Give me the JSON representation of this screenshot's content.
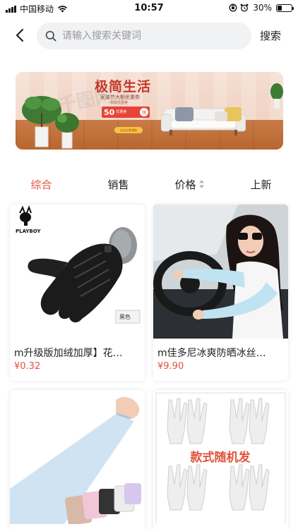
{
  "status_bar": {
    "carrier": "中国移动",
    "time": "10:57",
    "battery": "30%",
    "battery_level": 0.3
  },
  "header": {
    "back_icon": "chevron-left-icon",
    "search_icon": "search-icon",
    "search_placeholder": "请输入搜索关键词",
    "search_value": "",
    "search_button": "搜索"
  },
  "banner": {
    "title": "极简生活",
    "subtitle": "家装节大额优惠券",
    "small_text": "领取优惠券",
    "coupon_value": "50",
    "coupon_label": "优惠券",
    "coupon_badge": "领",
    "button_text": "点击立即领取"
  },
  "tabs": [
    {
      "label": "综合",
      "active": true
    },
    {
      "label": "销售",
      "active": false
    },
    {
      "label": "价格",
      "active": false,
      "icon": "sort-icon"
    },
    {
      "label": "上新",
      "active": false
    }
  ],
  "products": [
    {
      "title": "m升级版加绒加厚】花…",
      "price": "¥0.32",
      "brand": "PLAYBOY",
      "color_tag": "黑色"
    },
    {
      "title": "m佳多尼冰爽防晒冰丝…",
      "price": "¥9.90"
    },
    {
      "title": "",
      "price": ""
    },
    {
      "title": "",
      "price": "",
      "overlay_text": "款式随机发"
    }
  ],
  "colors": {
    "accent": "#e2533a",
    "search_bg": "#f1f2f4"
  }
}
